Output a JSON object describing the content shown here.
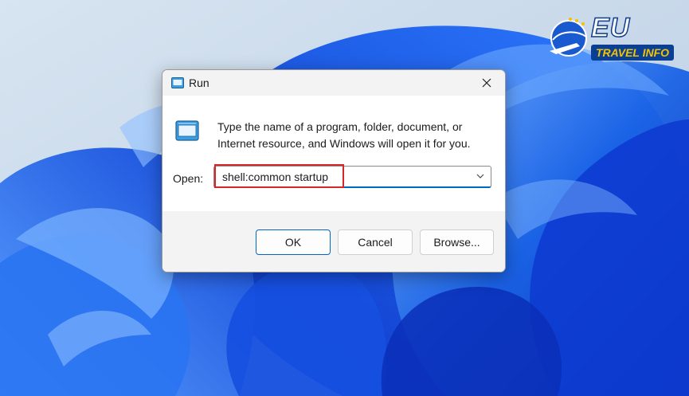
{
  "dialog": {
    "title": "Run",
    "title_icon": "run-icon",
    "close_icon": "close-icon",
    "description": "Type the name of a program, folder, document, or Internet resource, and Windows will open it for you.",
    "open_label": "Open:",
    "open_value": "shell:common startup",
    "dropdown_icon": "chevron-down-icon",
    "buttons": {
      "ok": "OK",
      "cancel": "Cancel",
      "browse": "Browse..."
    }
  },
  "watermark": {
    "line1": "EU",
    "line2": "TRAVEL INFO"
  },
  "colors": {
    "accent": "#0067c0",
    "highlight": "#d6262a",
    "wallpaper_blue": "#1f5fe0"
  }
}
